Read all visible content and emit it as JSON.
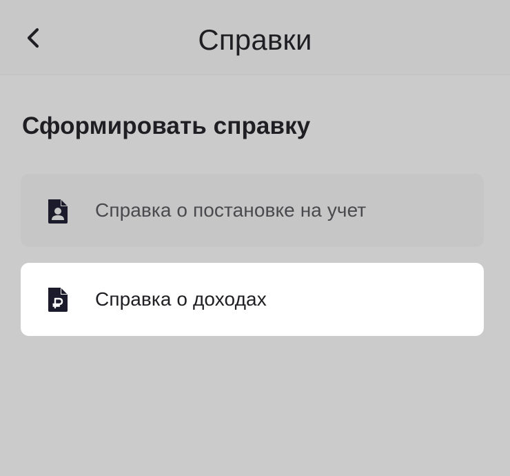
{
  "header": {
    "title": "Справки",
    "back_icon": "chevron-left-icon"
  },
  "section": {
    "title": "Сформировать справку"
  },
  "items": [
    {
      "label": "Справка о постановке на учет",
      "icon": "document-person-icon",
      "selected": false
    },
    {
      "label": "Справка о доходах",
      "icon": "document-ruble-icon",
      "selected": true
    }
  ],
  "colors": {
    "background": "#cbcbcb",
    "card_selected": "#ffffff",
    "card_default": "#c6c6c6",
    "text_primary": "#1f1f23",
    "icon": "#1b1b2b"
  }
}
